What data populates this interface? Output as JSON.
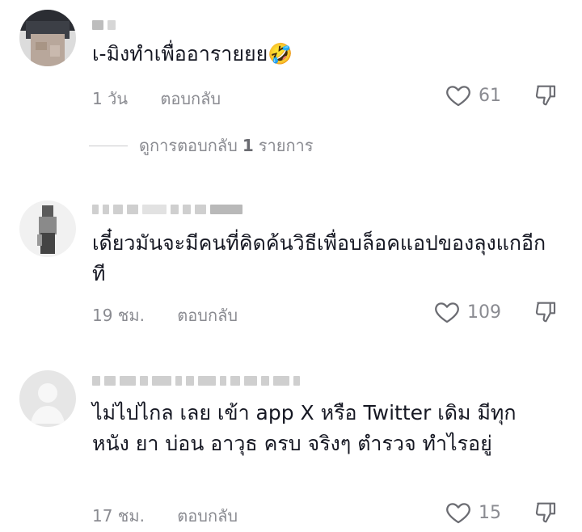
{
  "comments": [
    {
      "text": "เ-มิงทำเพื่ออารายยย🤣",
      "time": "1 วัน",
      "reply_label": "ตอบกลับ",
      "likes": "61"
    },
    {
      "text": "เดี๋ยวมันจะมีคนที่คิดค้นวิธีเพื่อบล็อคแอปของลุงแกอีกที",
      "time": "19 ชม.",
      "reply_label": "ตอบกลับ",
      "likes": "109"
    },
    {
      "text": "ไม่ไปไกล เลย เข้า app X หรือ Twitter เดิม มีทุก หนัง ยา บ่อน อาวุธ ครบ จริงๆ ตำรวจ ทำไรอยู่",
      "time": "17 ชม.",
      "reply_label": "ตอบกลับ",
      "likes": "15"
    }
  ],
  "view_replies": {
    "prefix": "ดูการตอบกลับ",
    "count": "1",
    "suffix": "รายการ"
  },
  "icons": {
    "like": "heart-outline-icon",
    "dislike": "thumbs-down-outline-icon"
  },
  "colors": {
    "text": "#161823",
    "secondary": "#8a8b91"
  }
}
